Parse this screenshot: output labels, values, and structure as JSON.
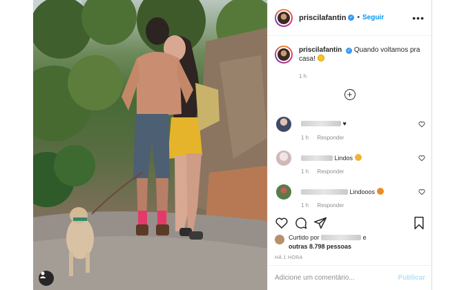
{
  "header": {
    "username": "priscilafantin",
    "verified_mark": "✓",
    "separator": "•",
    "follow_label": "Seguir",
    "more_icon": "more-horizontal-icon"
  },
  "caption": {
    "username": "priscilafantin",
    "text": "Quando voltamos pra casa!",
    "time": "1 h"
  },
  "load_more_icon": "plus-circle-icon",
  "comments": [
    {
      "text_suffix": "♥",
      "time": "1 h",
      "reply_label": "Responder",
      "avatar_color": "#3e4a66"
    },
    {
      "text_suffix": "Lindos",
      "emoji_color": "#f2b233",
      "time": "1 h",
      "reply_label": "Responder",
      "avatar_color": "#d9c7c7"
    },
    {
      "text_suffix": "Lindooos",
      "emoji_color": "#f08a24",
      "time": "1 h",
      "reply_label": "Responder",
      "avatar_color": "#5a7a4a"
    }
  ],
  "likes": {
    "prefix": "Curtido por",
    "connector": "e",
    "others": "outras 8.798 pessoas"
  },
  "timestamp": "HÁ 1 HORA",
  "add_comment": {
    "placeholder": "Adicione um comentário...",
    "publish_label": "Publicar"
  },
  "colors": {
    "accent": "#0095f6",
    "publish_disabled": "#b2dffc",
    "muted": "#8e8e8e"
  }
}
